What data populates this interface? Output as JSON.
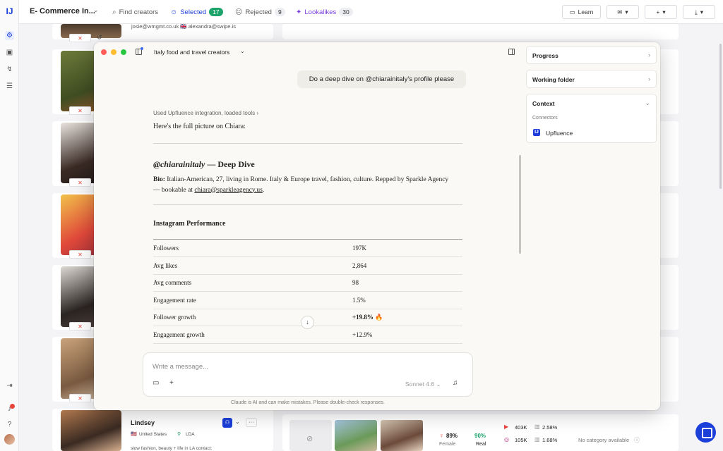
{
  "topbar": {
    "title": "E- Commerce In...",
    "find_creators": "Find creators",
    "selected": "Selected",
    "selected_count": "17",
    "rejected": "Rejected",
    "rejected_count": "9",
    "lookalikes": "Lookalikes",
    "lookalikes_count": "30",
    "learn": "Learn"
  },
  "background": {
    "top_card_contacts": "josie@wmgmt.co.uk 🇬🇧 alexandra@swipe.is",
    "lindsey": {
      "name": "Lindsey",
      "country": "United States",
      "location": "LDA",
      "bio": "slow fashion, beauty + life in LA contact:",
      "female_pct": "89%",
      "female_label": "Female",
      "real_pct": "90%",
      "real_label": "Real",
      "youtube": "403K",
      "youtube_rate": "2.58%",
      "instagram": "105K",
      "instagram_rate": "1.68%",
      "category": "No category available"
    }
  },
  "window": {
    "title": "Italy food and travel creators",
    "user_message": "Do a deep dive on @chiarainitaly’s profile please",
    "tool_line": "Used Upfluence integration, loaded tools",
    "intro": "Here's the full picture on Chiara:",
    "heading_handle": "@chiarainitaly",
    "heading_rest": " — Deep Dive",
    "bio_label": "Bio:",
    "bio_text": " Italian-American, 27, living in Rome. Italy & Europe travel, fashion, culture. Repped by Sparkle Agency — bookable at ",
    "bio_email": "chiara@sparkleagency.us",
    "bio_end": ".",
    "section_title": "Instagram Performance",
    "metrics": [
      {
        "label": "Followers",
        "value": "197K"
      },
      {
        "label": "Avg likes",
        "value": "2,864"
      },
      {
        "label": "Avg comments",
        "value": "98"
      },
      {
        "label": "Engagement rate",
        "value": "1.5%"
      },
      {
        "label": "Follower growth",
        "value": "+19.8% 🔥"
      },
      {
        "label": "Engagement growth",
        "value": "+12.9%"
      }
    ],
    "composer_placeholder": "Write a message...",
    "model": "Sonnet 4.6",
    "disclaimer": "Claude is AI and can make mistakes. Please double-check responses."
  },
  "panel": {
    "progress": "Progress",
    "working_folder": "Working folder",
    "context": "Context",
    "connectors": "Connectors",
    "connector_name": "Upfluence"
  },
  "colors": {
    "brand": "#1c3fd9",
    "selected_badge": "#1ea36a",
    "lookalikes": "#7b3fe0",
    "reject": "#e8443a"
  }
}
